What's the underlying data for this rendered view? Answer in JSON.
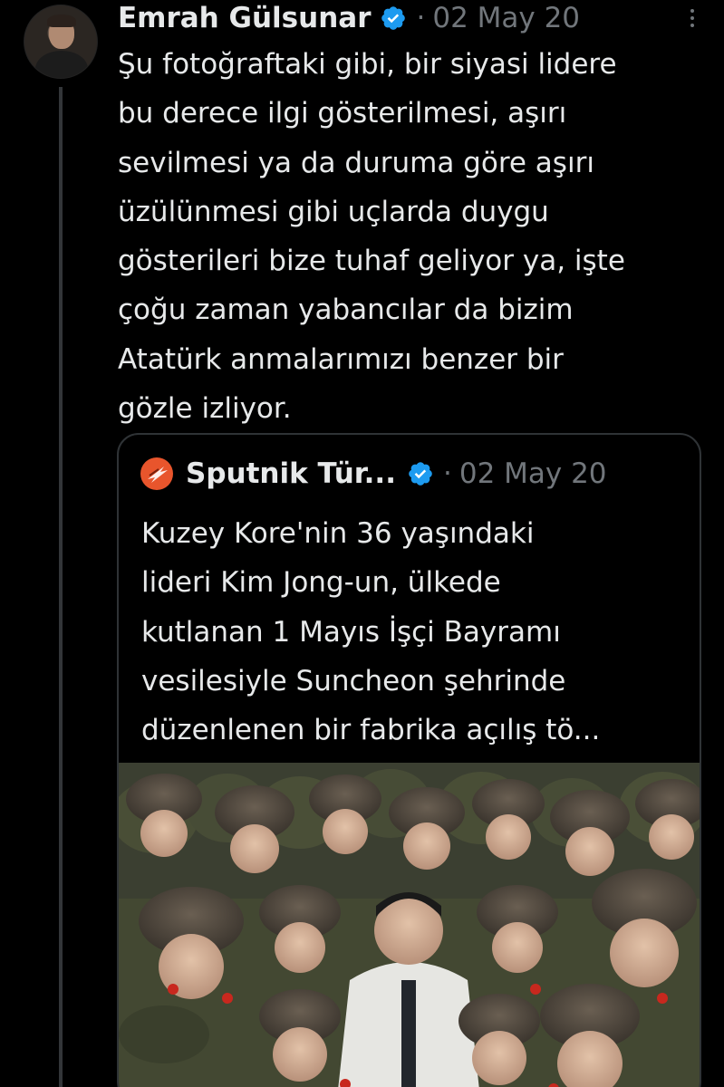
{
  "tweet": {
    "author_name": "Emrah Gülsunar",
    "dot": "·",
    "date": "02 May 20",
    "text_lines": [
      "Şu fotoğraftaki gibi, bir siyasi lidere",
      "bu derece ilgi gösterilmesi, aşırı",
      "sevilmesi ya da duruma göre aşırı",
      "üzülünmesi gibi uçlarda duygu",
      "gösterileri bize tuhaf geliyor ya, işte",
      "çoğu zaman yabancılar da bizim",
      "Atatürk anmalarımızı benzer bir",
      "gözle izliyor."
    ]
  },
  "quote": {
    "author_name": "Sputnik Tür...",
    "dot": "·",
    "date": "02 May 20",
    "text_lines": [
      "Kuzey Kore'nin 36 yaşındaki",
      "lideri Kim Jong-un, ülkede",
      "kutlanan 1 Mayıs İşçi Bayramı",
      "vesilesiyle Suncheon şehrinde",
      "düzenlenen bir fabrika açılış tö..."
    ]
  },
  "icons": {
    "verified": "verified-badge-icon",
    "more": "more-options-icon",
    "sputnik_logo": "sputnik-logo-icon"
  },
  "colors": {
    "background": "#000000",
    "text": "#e7e9ea",
    "muted": "#71767b",
    "verified": "#1d9bf0",
    "border": "#2f3336",
    "sputnik": "#e8552c"
  }
}
